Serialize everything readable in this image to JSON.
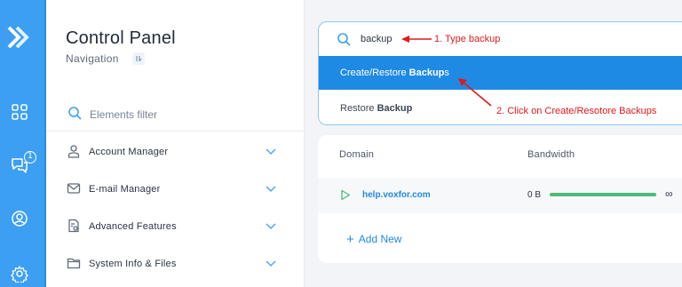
{
  "panel": {
    "title": "Control Panel",
    "subtitle": "Navigation",
    "filter_placeholder": "Elements filter",
    "nav_items": [
      {
        "label": "Account Manager",
        "icon": "user-icon"
      },
      {
        "label": "E-mail Manager",
        "icon": "mail-icon"
      },
      {
        "label": "Advanced Features",
        "icon": "advanced-features-icon"
      },
      {
        "label": "System Info & Files",
        "icon": "folder-icon"
      }
    ]
  },
  "rail": {
    "notification_count": "1",
    "icons": [
      "logo-icon",
      "grid-icon",
      "chat-icon",
      "profile-icon",
      "settings-icon"
    ]
  },
  "search": {
    "value": "backup",
    "results": [
      {
        "prefix": "Create/Restore ",
        "match": "Backup",
        "suffix": "s",
        "active": true
      },
      {
        "prefix": "Restore ",
        "match": "Backup",
        "suffix": "",
        "active": false
      }
    ]
  },
  "table": {
    "headers": [
      "Domain",
      "Bandwidth"
    ],
    "rows": [
      {
        "domain": "help.voxfor.com",
        "bandwidth": "0 B",
        "limit": "∞",
        "usage_fraction": 0.0
      }
    ],
    "add_new": "Add New"
  },
  "annotations": {
    "step1": "1. Type backup",
    "step2": "2. Click on Create/Resotore Backups",
    "color": "#e0191b"
  },
  "colors": {
    "accent": "#1f8ae3",
    "rail": "#3d9ff2",
    "bar_fill": "#4cbb7a"
  }
}
